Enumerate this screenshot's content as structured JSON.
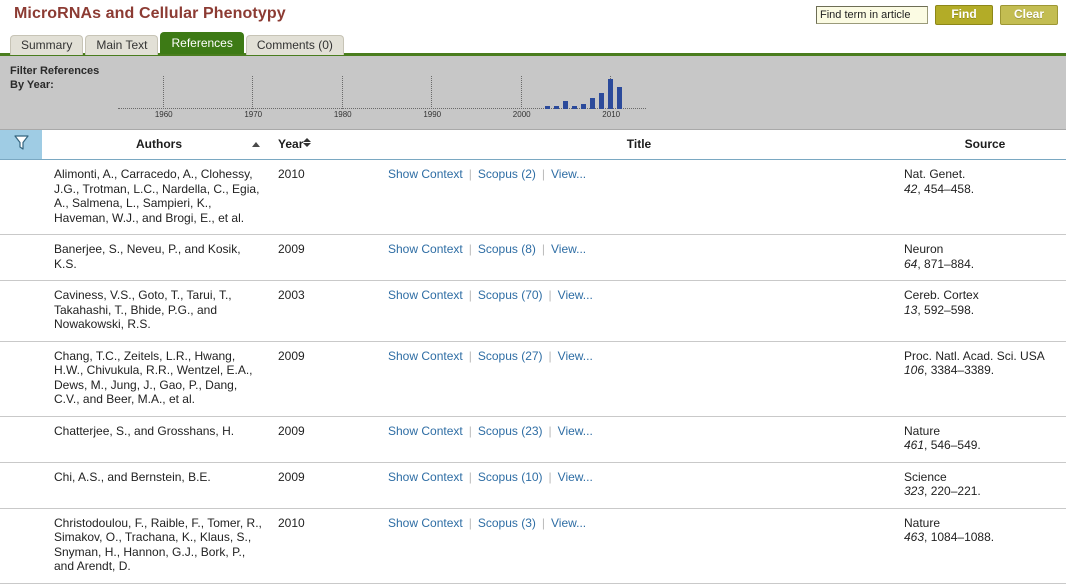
{
  "header": {
    "title": "MicroRNAs and Cellular Phenotypy",
    "find_input_value": "Find term in article",
    "find_input_placeholder": "Find term in article",
    "find_button": "Find",
    "clear_button": "Clear",
    "title_color": "#8c3b33"
  },
  "tabs": [
    {
      "label": "Summary",
      "active": false
    },
    {
      "label": "Main Text",
      "active": false
    },
    {
      "label": "References",
      "active": true
    },
    {
      "label": "Comments (0)",
      "active": false
    }
  ],
  "filter_panel": {
    "label_line1": "Filter References",
    "label_line2": "By Year:",
    "accent_color": "#2b4a9b"
  },
  "chart_data": {
    "type": "bar",
    "title": "Filter References By Year:",
    "xlabel": "",
    "ylabel": "",
    "grid": false,
    "legend": null,
    "xlim": [
      1955,
      2014
    ],
    "tick_labels": [
      "1960",
      "1970",
      "1980",
      "1990",
      "2000",
      "2010"
    ],
    "tick_values": [
      1960,
      1970,
      1980,
      1990,
      2000,
      2010
    ],
    "categories": [
      2003,
      2004,
      2005,
      2006,
      2007,
      2008,
      2009,
      2010,
      2011
    ],
    "values": [
      1,
      1,
      3,
      1,
      2,
      4,
      6,
      11,
      8
    ],
    "ylim": [
      0,
      12
    ]
  },
  "table": {
    "columns": {
      "filter_icon": "filter-icon",
      "authors": "Authors",
      "year": "Year",
      "title": "Title",
      "source": "Source"
    },
    "sort": {
      "column": "Authors",
      "direction": "asc"
    },
    "link_labels": {
      "show_context": "Show Context",
      "view": "View..."
    },
    "rows": [
      {
        "authors": "Alimonti, A., Carracedo, A., Clohessy, J.G., Trotman, L.C., Nardella, C., Egia, A., Salmena, L., Sampieri, K., Haveman, W.J., and Brogi, E., et al.",
        "year": "2010",
        "show_context": "Show Context",
        "scopus": "Scopus (2)",
        "view": "View...",
        "source_name": "Nat. Genet.",
        "source_volume": "42",
        "source_pages": ", 454–458."
      },
      {
        "authors": "Banerjee, S., Neveu, P., and Kosik, K.S.",
        "year": "2009",
        "show_context": "Show Context",
        "scopus": "Scopus (8)",
        "view": "View...",
        "source_name": "Neuron",
        "source_volume": "64",
        "source_pages": ", 871–884."
      },
      {
        "authors": "Caviness, V.S., Goto, T., Tarui, T., Takahashi, T., Bhide, P.G., and Nowakowski, R.S.",
        "year": "2003",
        "show_context": "Show Context",
        "scopus": "Scopus (70)",
        "view": "View...",
        "source_name": "Cereb. Cortex",
        "source_volume": "13",
        "source_pages": ", 592–598."
      },
      {
        "authors": "Chang, T.C., Zeitels, L.R., Hwang, H.W., Chivukula, R.R., Wentzel, E.A., Dews, M., Jung, J., Gao, P., Dang, C.V., and Beer, M.A., et al.",
        "year": "2009",
        "show_context": "Show Context",
        "scopus": "Scopus (27)",
        "view": "View...",
        "source_name": "Proc. Natl. Acad. Sci. USA",
        "source_volume": "106",
        "source_pages": ", 3384–3389."
      },
      {
        "authors": "Chatterjee, S., and Grosshans, H.",
        "year": "2009",
        "show_context": "Show Context",
        "scopus": "Scopus (23)",
        "view": "View...",
        "source_name": "Nature",
        "source_volume": "461",
        "source_pages": ", 546–549."
      },
      {
        "authors": "Chi, A.S., and Bernstein, B.E.",
        "year": "2009",
        "show_context": "Show Context",
        "scopus": "Scopus (10)",
        "view": "View...",
        "source_name": "Science",
        "source_volume": "323",
        "source_pages": ", 220–221."
      },
      {
        "authors": "Christodoulou, F., Raible, F., Tomer, R., Simakov, O., Trachana, K., Klaus, S., Snyman, H., Hannon, G.J., Bork, P., and Arendt, D.",
        "year": "2010",
        "show_context": "Show Context",
        "scopus": "Scopus (3)",
        "view": "View...",
        "source_name": "Nature",
        "source_volume": "463",
        "source_pages": ", 1084–1088."
      }
    ]
  }
}
